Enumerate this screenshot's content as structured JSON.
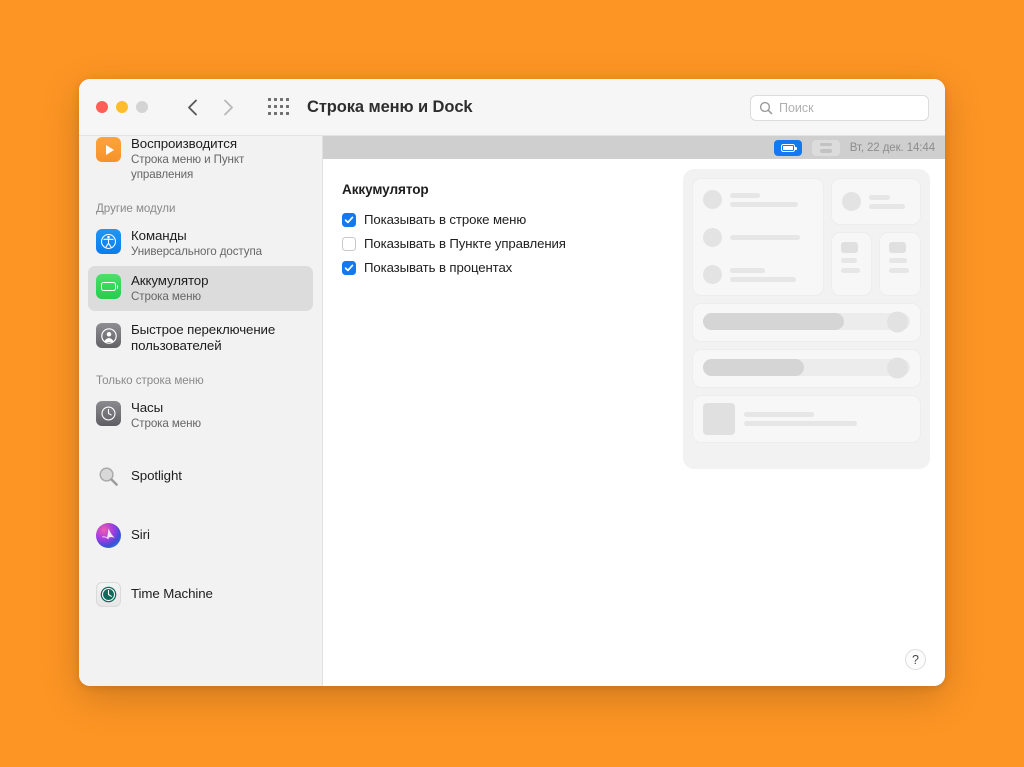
{
  "window": {
    "title": "Строка меню и Dock",
    "traffic_lights": [
      "close",
      "minimize",
      "maximize"
    ],
    "search": {
      "placeholder": "Поиск",
      "value": ""
    },
    "accent_blue": "#1479F0",
    "desktop_background": "#fd9524"
  },
  "sidebar": {
    "top_item": {
      "title": "Воспроизводится",
      "subtitle_line1": "Строка меню и Пункт",
      "subtitle_line2": "управления",
      "icon": "now-playing-icon"
    },
    "groups": [
      {
        "label": "Другие модули",
        "items": [
          {
            "title": "Команды",
            "subtitle": "Универсального доступа",
            "icon": "accessibility-icon",
            "selected": false
          },
          {
            "title": "Аккумулятор",
            "subtitle": "Строка меню",
            "icon": "battery-icon",
            "selected": true
          },
          {
            "title": "Быстрое переключение",
            "subtitle": "пользователей",
            "icon": "user-switch-icon",
            "selected": false
          }
        ]
      },
      {
        "label": "Только строка меню",
        "items": [
          {
            "title": "Часы",
            "subtitle": "Строка меню",
            "icon": "clock-icon",
            "selected": false
          },
          {
            "title": "Spotlight",
            "subtitle": "",
            "icon": "spotlight-icon",
            "selected": false
          },
          {
            "title": "Siri",
            "subtitle": "",
            "icon": "siri-icon",
            "selected": false
          },
          {
            "title": "Time Machine",
            "subtitle": "",
            "icon": "time-machine-icon",
            "selected": false
          }
        ]
      }
    ]
  },
  "menu_bar_preview": {
    "battery_chip": "battery-icon",
    "control_center_chip": "control-center-icon",
    "clock": "Вт, 22 дек.  14:44"
  },
  "main": {
    "section_title": "Аккумулятор",
    "checkboxes": [
      {
        "label": "Показывать в строке меню",
        "checked": true
      },
      {
        "label": "Показывать в Пункте управления",
        "checked": false
      },
      {
        "label": "Показывать в процентах",
        "checked": true
      }
    ],
    "help_button": "?"
  },
  "control_center_preview": {
    "description": "placeholder-mockup",
    "left_items": 3,
    "sliders": [
      {
        "fill_percent": 68
      },
      {
        "fill_percent": 49
      }
    ],
    "tiles": 2
  }
}
